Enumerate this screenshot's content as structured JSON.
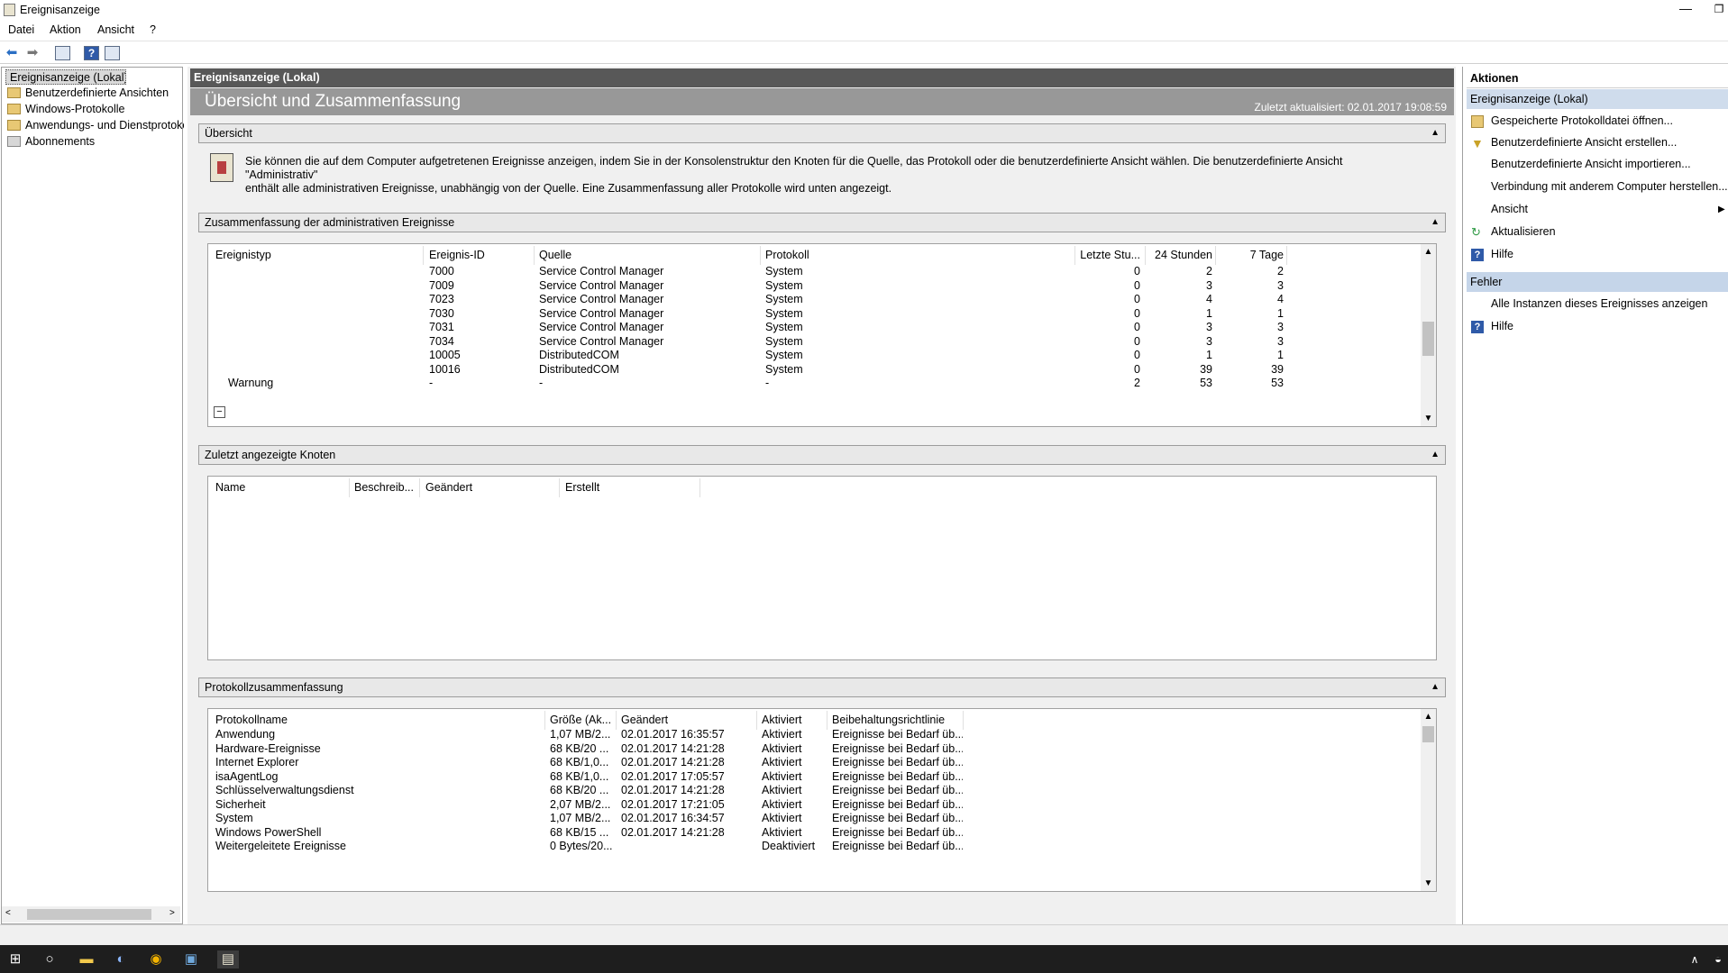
{
  "window": {
    "title": "Ereignisanzeige"
  },
  "menu": [
    "Datei",
    "Aktion",
    "Ansicht",
    "?"
  ],
  "tree": {
    "items": [
      "Ereignisanzeige (Lokal)",
      "Benutzerdefinierte Ansichten",
      "Windows-Protokolle",
      "Anwendungs- und Dienstprotokolle",
      "Abonnements"
    ]
  },
  "center": {
    "header": "Ereignisanzeige (Lokal)",
    "banner_title": "Übersicht und Zusammenfassung",
    "last_updated": "Zuletzt aktualisiert: 02.01.2017 19:08:59",
    "overview": {
      "title": "Übersicht",
      "line1": "Sie können die auf dem Computer aufgetretenen Ereignisse anzeigen, indem Sie in der Konsolenstruktur den Knoten für die Quelle, das Protokoll oder die benutzerdefinierte Ansicht wählen. Die benutzerdefinierte Ansicht \"Administrativ\"",
      "line2": "enthält alle administrativen Ereignisse, unabhängig von der Quelle. Eine Zusammenfassung aller Protokolle wird unten angezeigt."
    },
    "admin_summary": {
      "title": "Zusammenfassung der administrativen Ereignisse",
      "columns": [
        "Ereignistyp",
        "Ereignis-ID",
        "Quelle",
        "Protokoll",
        "Letzte Stu...",
        "24 Stunden",
        "7 Tage"
      ],
      "rows": [
        [
          "",
          "7000",
          "Service Control Manager",
          "System",
          "0",
          "2",
          "2"
        ],
        [
          "",
          "7009",
          "Service Control Manager",
          "System",
          "0",
          "3",
          "3"
        ],
        [
          "",
          "7023",
          "Service Control Manager",
          "System",
          "0",
          "4",
          "4"
        ],
        [
          "",
          "7030",
          "Service Control Manager",
          "System",
          "0",
          "1",
          "1"
        ],
        [
          "",
          "7031",
          "Service Control Manager",
          "System",
          "0",
          "3",
          "3"
        ],
        [
          "",
          "7034",
          "Service Control Manager",
          "System",
          "0",
          "3",
          "3"
        ],
        [
          "",
          "10005",
          "DistributedCOM",
          "System",
          "0",
          "1",
          "1"
        ],
        [
          "",
          "10016",
          "DistributedCOM",
          "System",
          "0",
          "39",
          "39"
        ],
        [
          "Warnung",
          "-",
          "-",
          "-",
          "2",
          "53",
          "53"
        ]
      ]
    },
    "recent_nodes": {
      "title": "Zuletzt angezeigte Knoten",
      "columns": [
        "Name",
        "Beschreib...",
        "Geändert",
        "Erstellt"
      ]
    },
    "log_summary": {
      "title": "Protokollzusammenfassung",
      "columns": [
        "Protokollname",
        "Größe (Ak...",
        "Geändert",
        "Aktiviert",
        "Beibehaltungsrichtlinie"
      ],
      "rows": [
        [
          "Anwendung",
          "1,07 MB/2...",
          "02.01.2017 16:35:57",
          "Aktiviert",
          "Ereignisse bei Bedarf üb..."
        ],
        [
          "Hardware-Ereignisse",
          "68 KB/20 ...",
          "02.01.2017 14:21:28",
          "Aktiviert",
          "Ereignisse bei Bedarf üb..."
        ],
        [
          "Internet Explorer",
          "68 KB/1,0...",
          "02.01.2017 14:21:28",
          "Aktiviert",
          "Ereignisse bei Bedarf üb..."
        ],
        [
          "isaAgentLog",
          "68 KB/1,0...",
          "02.01.2017 17:05:57",
          "Aktiviert",
          "Ereignisse bei Bedarf üb..."
        ],
        [
          "Schlüsselverwaltungsdienst",
          "68 KB/20 ...",
          "02.01.2017 14:21:28",
          "Aktiviert",
          "Ereignisse bei Bedarf üb..."
        ],
        [
          "Sicherheit",
          "2,07 MB/2...",
          "02.01.2017 17:21:05",
          "Aktiviert",
          "Ereignisse bei Bedarf üb..."
        ],
        [
          "System",
          "1,07 MB/2...",
          "02.01.2017 16:34:57",
          "Aktiviert",
          "Ereignisse bei Bedarf üb..."
        ],
        [
          "Windows PowerShell",
          "68 KB/15 ...",
          "02.01.2017 14:21:28",
          "Aktiviert",
          "Ereignisse bei Bedarf üb..."
        ],
        [
          "Weitergeleitete Ereignisse",
          "0 Bytes/20...",
          "",
          "Deaktiviert",
          "Ereignisse bei Bedarf üb..."
        ]
      ]
    }
  },
  "actions": {
    "title": "Aktionen",
    "group1": "Ereignisanzeige (Lokal)",
    "group1_items": [
      "Gespeicherte Protokolldatei öffnen...",
      "Benutzerdefinierte Ansicht erstellen...",
      "Benutzerdefinierte Ansicht importieren...",
      "Verbindung mit anderem Computer herstellen...",
      "Ansicht",
      "Aktualisieren",
      "Hilfe"
    ],
    "group2": "Fehler",
    "group2_items": [
      "Alle Instanzen dieses Ereignisses anzeigen",
      "Hilfe"
    ]
  },
  "colors": {
    "header_dark": "#585858",
    "banner_gray": "#989898",
    "actions_selected": "#cfdcec",
    "actions_group": "#c5d5e9",
    "taskbar": "#1e1e1e"
  }
}
